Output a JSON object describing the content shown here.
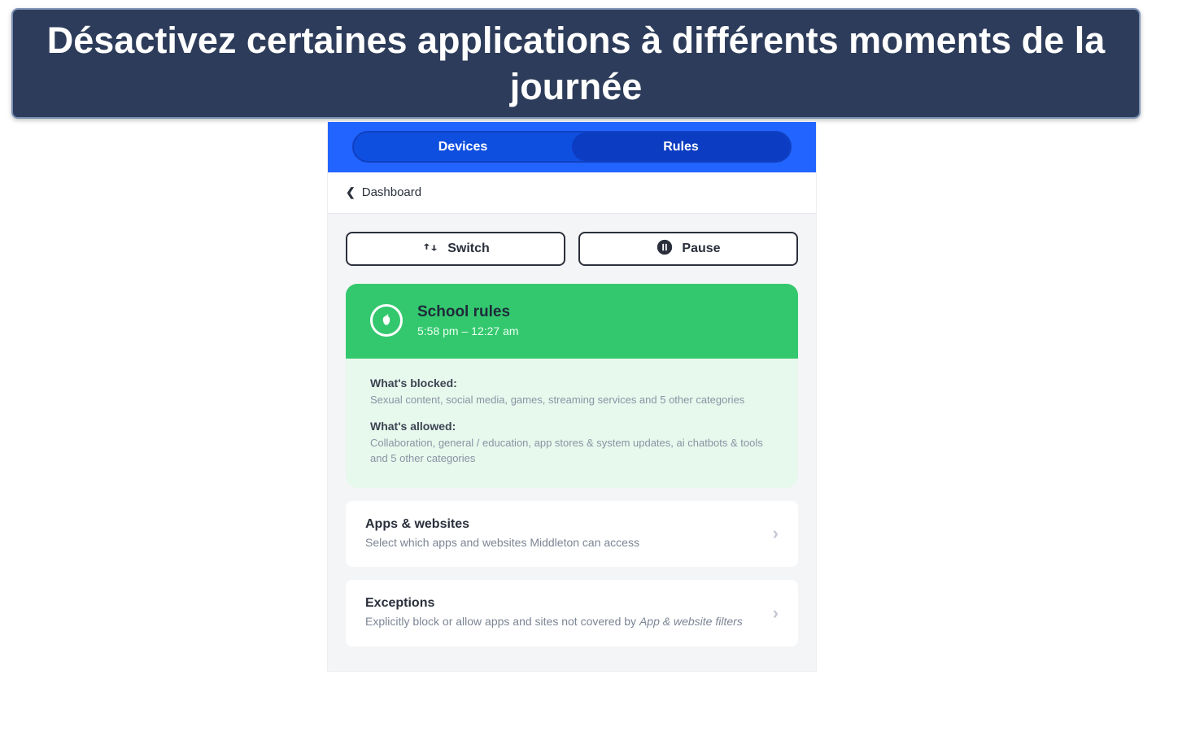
{
  "banner": {
    "text": "Désactivez certaines applications à différents moments de la journée"
  },
  "tabs": {
    "devices": "Devices",
    "rules": "Rules"
  },
  "breadcrumb": {
    "label": "Dashboard"
  },
  "actions": {
    "switch": "Switch",
    "pause": "Pause"
  },
  "rule": {
    "title": "School rules",
    "time": "5:58 pm – 12:27 am",
    "blocked_label": "What's blocked:",
    "blocked_text": "Sexual content, social media, games, streaming services and 5 other categories",
    "allowed_label": "What's allowed:",
    "allowed_text": "Collaboration, general / education, app stores & system updates, ai chatbots & tools and 5 other categories"
  },
  "items": {
    "apps": {
      "title": "Apps & websites",
      "desc": "Select which apps and websites Middleton can access"
    },
    "exceptions": {
      "title": "Exceptions",
      "desc_prefix": "Explicitly block or allow apps and sites not covered by ",
      "desc_em": "App & website filters"
    }
  }
}
